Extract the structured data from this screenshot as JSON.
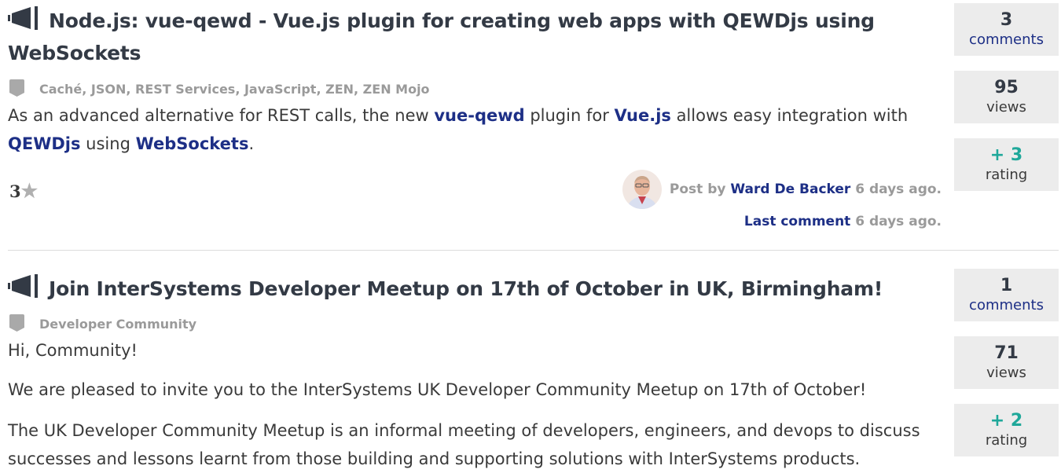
{
  "posts": [
    {
      "title": "Node.js: vue-qewd - Vue.js plugin for creating web apps with QEWDjs using WebSockets",
      "tags": "Caché, JSON, REST Services, JavaScript, ZEN, ZEN Mojo",
      "desc": {
        "t1": "As an advanced alternative for REST calls, the new ",
        "l1": "vue-qewd",
        "t2": " plugin for ",
        "l2": "Vue.js",
        "t3": " allows easy integration with ",
        "l3": "QEWDjs",
        "t4": " using ",
        "l4": "WebSockets",
        "t5": "."
      },
      "rating_value": "3",
      "post_by": "Post by",
      "author": "Ward De Backer",
      "posted_ago": "6 days ago.",
      "last_comment_label": "Last comment",
      "last_comment_ago": "6 days ago.",
      "stats": {
        "comments": {
          "num": "3",
          "label": "comments"
        },
        "views": {
          "num": "95",
          "label": "views"
        },
        "rating": {
          "num": "+ 3",
          "label": "rating"
        }
      }
    },
    {
      "title": "Join InterSystems Developer Meetup on 17th of October in UK, Birmingham!",
      "tags": "Developer Community",
      "p1": "Hi, Community!",
      "p2": "We are pleased to invite you to the InterSystems UK Developer Community Meetup on 17th of October!",
      "p3": "The UK Developer Community Meetup is an informal meeting of developers, engineers, and devops to discuss successes and lessons learnt from those building and supporting solutions with InterSystems products.",
      "stats": {
        "comments": {
          "num": "1",
          "label": "comments"
        },
        "views": {
          "num": "71",
          "label": "views"
        },
        "rating": {
          "num": "+ 2",
          "label": "rating"
        }
      }
    }
  ],
  "icons": {
    "post_type": "megaphone-icon",
    "tag": "tag-icon",
    "star": "star-icon"
  },
  "colors": {
    "link": "#1d2f86",
    "rating_positive": "#1fa89a",
    "stat_bg": "#ececec",
    "muted": "#9a9a9a"
  }
}
